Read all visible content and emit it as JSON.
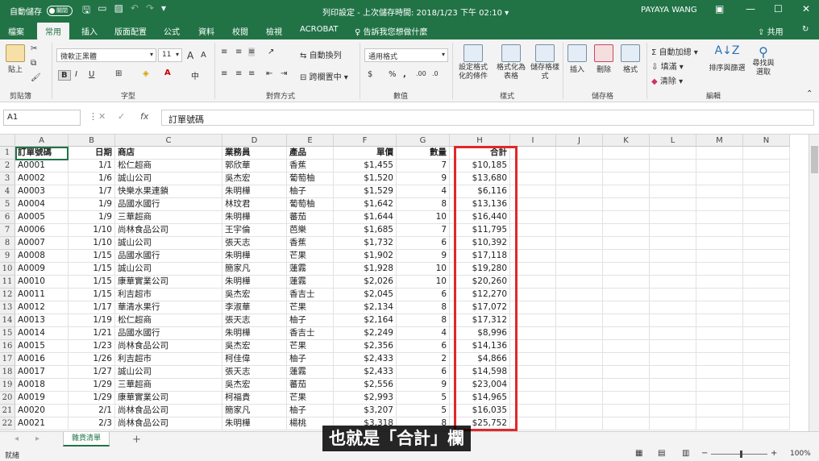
{
  "titlebar": {
    "autosave": "自動儲存",
    "toggle": "關閉",
    "title": "列印設定 - 上次儲存時間: 2018/1/23 下午 02:10 ▾",
    "user": "PAYAYA WANG"
  },
  "tabs": [
    "檔案",
    "常用",
    "插入",
    "版面配置",
    "公式",
    "資料",
    "校閱",
    "檢視",
    "ACROBAT",
    "告訴我您想做什麼"
  ],
  "tab_right": {
    "share": "共用"
  },
  "ribbon": {
    "clipboard": {
      "paste": "貼上",
      "label": "剪貼簿"
    },
    "font": {
      "name": "微軟正黑體",
      "size": "11",
      "grow": "A",
      "shrink": "A",
      "bold": "B",
      "italic": "I",
      "underline": "U",
      "label": "字型"
    },
    "align": {
      "wrap": "自動換列",
      "merge": "跨欄置中",
      "label": "對齊方式"
    },
    "number": {
      "format": "通用格式",
      "currency": "$",
      "percent": "%",
      "comma": ",",
      "label": "數值"
    },
    "styles": {
      "cond": "設定格式化的條件",
      "table": "格式化為表格",
      "cell": "儲存格樣式",
      "label": "樣式"
    },
    "cells": {
      "insert": "插入",
      "delete": "刪除",
      "format": "格式",
      "label": "儲存格"
    },
    "editing": {
      "autosum": "自動加總",
      "fill": "填滿",
      "clear": "清除",
      "sort": "排序與篩選",
      "find": "尋找與選取",
      "label": "編輯"
    }
  },
  "formula": {
    "namebox": "A1",
    "value": "訂單號碼",
    "fx": "fx"
  },
  "columns": [
    "A",
    "B",
    "C",
    "D",
    "E",
    "F",
    "G",
    "H",
    "I",
    "J",
    "K",
    "L",
    "M",
    "N"
  ],
  "table": {
    "headers": [
      "訂單號碼",
      "日期",
      "商店",
      "業務員",
      "產品",
      "單價",
      "數量",
      "合計"
    ],
    "rows": [
      [
        "A0001",
        "1/1",
        "松仁超商",
        "郭欣華",
        "香蕉",
        "$1,455",
        "7",
        "$10,185"
      ],
      [
        "A0002",
        "1/6",
        "誠山公司",
        "吳杰宏",
        "葡萄柚",
        "$1,520",
        "9",
        "$13,680"
      ],
      [
        "A0003",
        "1/7",
        "快樂水果連鎖",
        "朱明樺",
        "柚子",
        "$1,529",
        "4",
        "$6,116"
      ],
      [
        "A0004",
        "1/9",
        "品國水國行",
        "林玟君",
        "葡萄柚",
        "$1,642",
        "8",
        "$13,136"
      ],
      [
        "A0005",
        "1/9",
        "三華超商",
        "朱明樺",
        "蕃茄",
        "$1,644",
        "10",
        "$16,440"
      ],
      [
        "A0006",
        "1/10",
        "尚林食品公司",
        "王宇倫",
        "芭樂",
        "$1,685",
        "7",
        "$11,795"
      ],
      [
        "A0007",
        "1/10",
        "誠山公司",
        "張天志",
        "香蕉",
        "$1,732",
        "6",
        "$10,392"
      ],
      [
        "A0008",
        "1/15",
        "品國水國行",
        "朱明樺",
        "芒果",
        "$1,902",
        "9",
        "$17,118"
      ],
      [
        "A0009",
        "1/15",
        "誠山公司",
        "簡家凡",
        "蓮霧",
        "$1,928",
        "10",
        "$19,280"
      ],
      [
        "A0010",
        "1/15",
        "康華實業公司",
        "朱明樺",
        "蓮霧",
        "$2,026",
        "10",
        "$20,260"
      ],
      [
        "A0011",
        "1/15",
        "利吉超市",
        "吳杰宏",
        "香吉士",
        "$2,045",
        "6",
        "$12,270"
      ],
      [
        "A0012",
        "1/17",
        "華清水果行",
        "李淑華",
        "芒果",
        "$2,134",
        "8",
        "$17,072"
      ],
      [
        "A0013",
        "1/19",
        "松仁超商",
        "張天志",
        "柚子",
        "$2,164",
        "8",
        "$17,312"
      ],
      [
        "A0014",
        "1/21",
        "品國水國行",
        "朱明樺",
        "香吉士",
        "$2,249",
        "4",
        "$8,996"
      ],
      [
        "A0015",
        "1/23",
        "尚林食品公司",
        "吳杰宏",
        "芒果",
        "$2,356",
        "6",
        "$14,136"
      ],
      [
        "A0016",
        "1/26",
        "利吉超市",
        "柯佳偉",
        "柚子",
        "$2,433",
        "2",
        "$4,866"
      ],
      [
        "A0017",
        "1/27",
        "誠山公司",
        "張天志",
        "蓮霧",
        "$2,433",
        "6",
        "$14,598"
      ],
      [
        "A0018",
        "1/29",
        "三華超商",
        "吳杰宏",
        "蕃茄",
        "$2,556",
        "9",
        "$23,004"
      ],
      [
        "A0019",
        "1/29",
        "康華實業公司",
        "柯福貴",
        "芒果",
        "$2,993",
        "5",
        "$14,965"
      ],
      [
        "A0020",
        "2/1",
        "尚林食品公司",
        "簡家凡",
        "柚子",
        "$3,207",
        "5",
        "$16,035"
      ],
      [
        "A0021",
        "2/3",
        "尚林食品公司",
        "朱明樺",
        "楊桃",
        "$3,318",
        "8",
        "$25,752"
      ]
    ]
  },
  "sheet": {
    "tab": "雜貨清單",
    "add": "+"
  },
  "status": {
    "left": "就緒",
    "zoom": "100%"
  },
  "subtitle": "也就是「合計」欄"
}
